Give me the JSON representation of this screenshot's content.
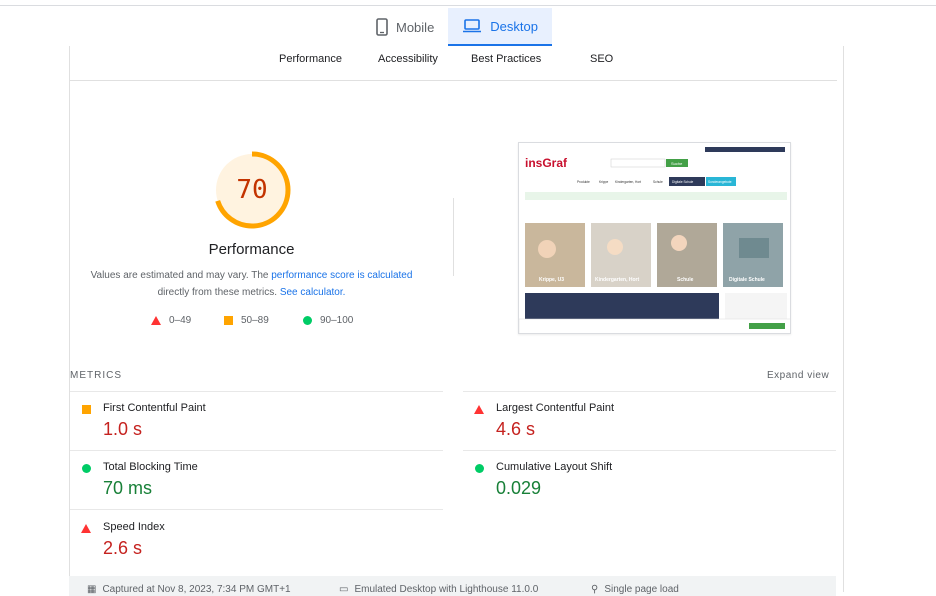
{
  "device_tabs": [
    {
      "label": "Mobile",
      "icon": "smartphone-icon",
      "active": false
    },
    {
      "label": "Desktop",
      "icon": "laptop-icon",
      "active": true
    }
  ],
  "category_tabs": [
    "Performance",
    "Accessibility",
    "Best Practices",
    "SEO"
  ],
  "score": {
    "value": "70",
    "fraction": 0.7,
    "title": "Performance",
    "desc_prefix": "Values are estimated and may vary. The ",
    "desc_link1": "performance score is calculated",
    "desc_mid": " directly from these metrics. ",
    "desc_link2": "See calculator.",
    "colors": {
      "ring": "#ffa400",
      "track": "#fff3e0",
      "text": "#c33300"
    }
  },
  "legend": [
    {
      "shape": "triangle",
      "range": "0–49",
      "color": "#ff3333"
    },
    {
      "shape": "square",
      "range": "50–89",
      "color": "#ffa400"
    },
    {
      "shape": "circle",
      "range": "90–100",
      "color": "#00cc66"
    }
  ],
  "screenshot": {
    "logo": "insGraf",
    "search_button": "Suche",
    "nav_items": [
      "Produkte",
      "Krippe",
      "Kindergarten, Hort",
      "Schule",
      "Digitale Schule",
      "Sonderangebote"
    ],
    "tiles": [
      "Krippe, U3",
      "Kindergarten, Hort",
      "Schule",
      "Digitale Schule"
    ]
  },
  "metrics": {
    "header": "METRICS",
    "expand": "Expand view",
    "items": [
      {
        "label": "First Contentful Paint",
        "value": "1.0 s",
        "status": "average"
      },
      {
        "label": "Largest Contentful Paint",
        "value": "4.6 s",
        "status": "fail"
      },
      {
        "label": "Total Blocking Time",
        "value": "70 ms",
        "status": "pass"
      },
      {
        "label": "Cumulative Layout Shift",
        "value": "0.029",
        "status": "pass"
      },
      {
        "label": "Speed Index",
        "value": "2.6 s",
        "status": "fail"
      }
    ]
  },
  "footer": {
    "captured": "Captured at Nov 8, 2023, 7:34 PM GMT+1",
    "emulated": "Emulated Desktop with Lighthouse 11.0.0",
    "load": "Single page load"
  }
}
